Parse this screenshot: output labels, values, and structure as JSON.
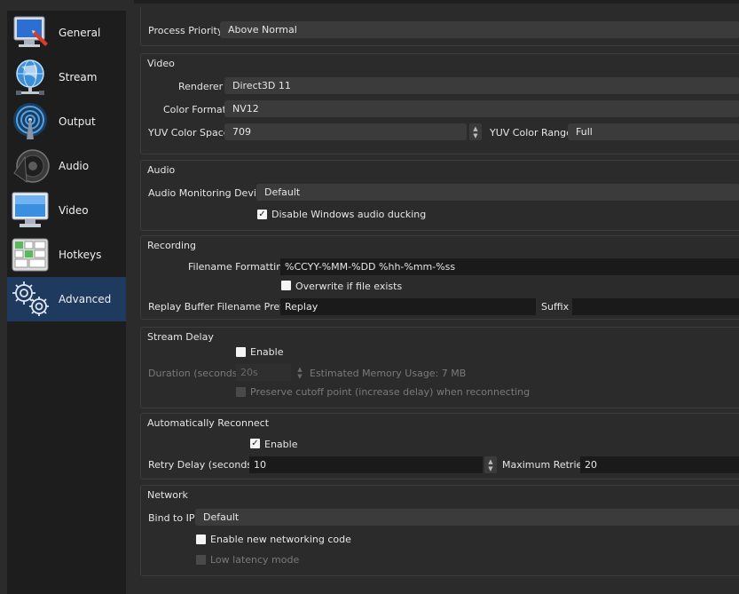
{
  "sidebar": {
    "items": [
      {
        "label": "General",
        "icon": "monitor-pencil-icon"
      },
      {
        "label": "Stream",
        "icon": "globe-network-icon"
      },
      {
        "label": "Output",
        "icon": "broadcast-antenna-icon"
      },
      {
        "label": "Audio",
        "icon": "speaker-icon"
      },
      {
        "label": "Video",
        "icon": "monitor-icon"
      },
      {
        "label": "Hotkeys",
        "icon": "keyboard-icon"
      },
      {
        "label": "Advanced",
        "icon": "gears-icon"
      }
    ],
    "active": "Advanced"
  },
  "general": {
    "process_priority_label": "Process Priority",
    "process_priority_value": "Above Normal"
  },
  "video": {
    "title": "Video",
    "renderer_label": "Renderer",
    "renderer_value": "Direct3D 11",
    "color_format_label": "Color Format",
    "color_format_value": "NV12",
    "yuv_space_label": "YUV Color Space",
    "yuv_space_value": "709",
    "yuv_range_label": "YUV Color Range",
    "yuv_range_value": "Full"
  },
  "audio": {
    "title": "Audio",
    "monitoring_label": "Audio Monitoring Device",
    "monitoring_value": "Default",
    "ducking_label": "Disable Windows audio ducking",
    "ducking_checked": true
  },
  "recording": {
    "title": "Recording",
    "filename_label": "Filename Formatting",
    "filename_value": "%CCYY-%MM-%DD %hh-%mm-%ss",
    "overwrite_label": "Overwrite if file exists",
    "overwrite_checked": false,
    "replay_prefix_label": "Replay Buffer Filename Prefix",
    "replay_prefix_value": "Replay",
    "suffix_label": "Suffix",
    "suffix_value": ""
  },
  "stream_delay": {
    "title": "Stream Delay",
    "enable_label": "Enable",
    "enable_checked": false,
    "duration_label": "Duration (seconds)",
    "duration_value": "20s",
    "memory_label": "Estimated Memory Usage: 7 MB",
    "preserve_label": "Preserve cutoff point (increase delay) when reconnecting",
    "preserve_checked": false
  },
  "reconnect": {
    "title": "Automatically Reconnect",
    "enable_label": "Enable",
    "enable_checked": true,
    "retry_delay_label": "Retry Delay (seconds)",
    "retry_delay_value": "10",
    "max_retries_label": "Maximum Retries",
    "max_retries_value": "20"
  },
  "network": {
    "title": "Network",
    "bind_label": "Bind to IP",
    "bind_value": "Default",
    "new_code_label": "Enable new networking code",
    "new_code_checked": false,
    "low_latency_label": "Low latency mode",
    "low_latency_checked": false
  },
  "colors": {
    "background": "#2b2b2b",
    "sidebar": "#1d1d1d",
    "active_item": "#1e3a5f",
    "field": "#3b3b3b",
    "text_field": "#1a1a1a"
  }
}
